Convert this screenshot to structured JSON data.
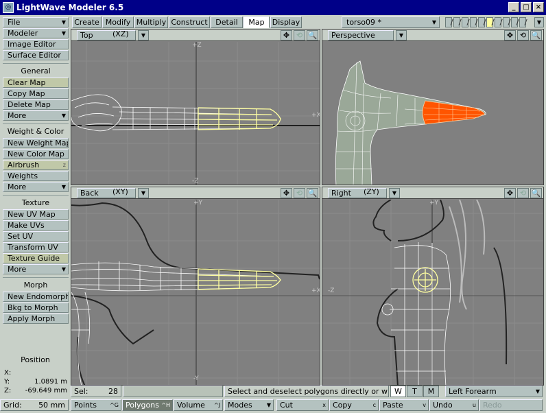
{
  "window": {
    "title": "LightWave Modeler 6.5",
    "app_icon": "lw-icon",
    "controls": [
      "_",
      "□",
      "×"
    ]
  },
  "left_panel": {
    "buttons": [
      {
        "label": "File",
        "drop": true
      },
      {
        "label": "Modeler",
        "drop": true
      },
      {
        "label": "Image Editor"
      },
      {
        "label": "Surface Editor"
      }
    ],
    "sections": [
      {
        "title": "General",
        "items": [
          {
            "label": "Clear Map",
            "hl": true
          },
          {
            "label": "Copy Map"
          },
          {
            "label": "Delete Map"
          },
          {
            "label": "More",
            "drop": true
          }
        ]
      },
      {
        "title": "Weight & Color",
        "items": [
          {
            "label": "New Weight Map"
          },
          {
            "label": "New Color Map"
          },
          {
            "label": "Airbrush",
            "hotkey": "z",
            "hl": true
          },
          {
            "label": "Weights"
          },
          {
            "label": "More",
            "drop": true
          }
        ]
      },
      {
        "title": "Texture",
        "items": [
          {
            "label": "New UV Map"
          },
          {
            "label": "Make UVs"
          },
          {
            "label": "Set UV"
          },
          {
            "label": "Transform UV"
          },
          {
            "label": "Texture Guide",
            "hl": true
          },
          {
            "label": "More",
            "drop": true
          }
        ]
      },
      {
        "title": "Morph",
        "items": [
          {
            "label": "New Endomorph"
          },
          {
            "label": "Bkg to Morph"
          },
          {
            "label": "Apply Morph"
          }
        ]
      }
    ],
    "position": {
      "title": "Position",
      "x_label": "X:",
      "x_value": "",
      "y_label": "Y:",
      "y_value": "1.0891 m",
      "z_label": "Z:",
      "z_value": "-69.649 mm"
    }
  },
  "tabs": [
    "Create",
    "Modify",
    "Multiply",
    "Construct",
    "Detail",
    "Map",
    "Display"
  ],
  "active_tab": "Map",
  "object_select": "torso09 *",
  "viewports": [
    {
      "name": "Top",
      "axis": "(XZ)",
      "icons": [
        "✥",
        "⟲",
        "🔍"
      ]
    },
    {
      "name": "Perspective",
      "axis": "",
      "icons": [
        "✥",
        "⟲",
        "🔍"
      ]
    },
    {
      "name": "Back",
      "axis": "(XY)",
      "icons": [
        "✥",
        "⟲",
        "🔍"
      ]
    },
    {
      "name": "Right",
      "axis": "(ZY)",
      "icons": [
        "✥",
        "⟲",
        "🔍"
      ]
    }
  ],
  "axis_labels": {
    "top_plus_z": "+Z",
    "top_plus_x": "+X",
    "top_minus_z": "-Z",
    "back_plus_y": "+Y",
    "back_plus_x": "+X",
    "back_minus_y": "-Y",
    "right_plus_y": "+Y",
    "right_minus_z": "-Z"
  },
  "status": {
    "sel_label": "Sel:",
    "sel_count": "28",
    "message": "Select and deselect polygons directly or with las...",
    "wtm": [
      "W",
      "T",
      "M"
    ],
    "map_name": "Left Forearm"
  },
  "bottom": {
    "grid_label": "Grid:",
    "grid_value": "50 mm",
    "modes": [
      {
        "label": "Points",
        "hotkey": "^G"
      },
      {
        "label": "Polygons",
        "hotkey": "^H",
        "selected": true
      },
      {
        "label": "Volume",
        "hotkey": "^J"
      }
    ],
    "modes_menu": "Modes",
    "edit": [
      {
        "label": "Cut",
        "hotkey": "x"
      },
      {
        "label": "Copy",
        "hotkey": "c"
      },
      {
        "label": "Paste",
        "hotkey": "v"
      },
      {
        "label": "Undo",
        "hotkey": "u"
      },
      {
        "label": "Redo",
        "disabled": true
      }
    ]
  },
  "colors": {
    "titlebar": "#000088",
    "viewport_bg": "#808080",
    "highlight_poly": "#ff5500"
  }
}
